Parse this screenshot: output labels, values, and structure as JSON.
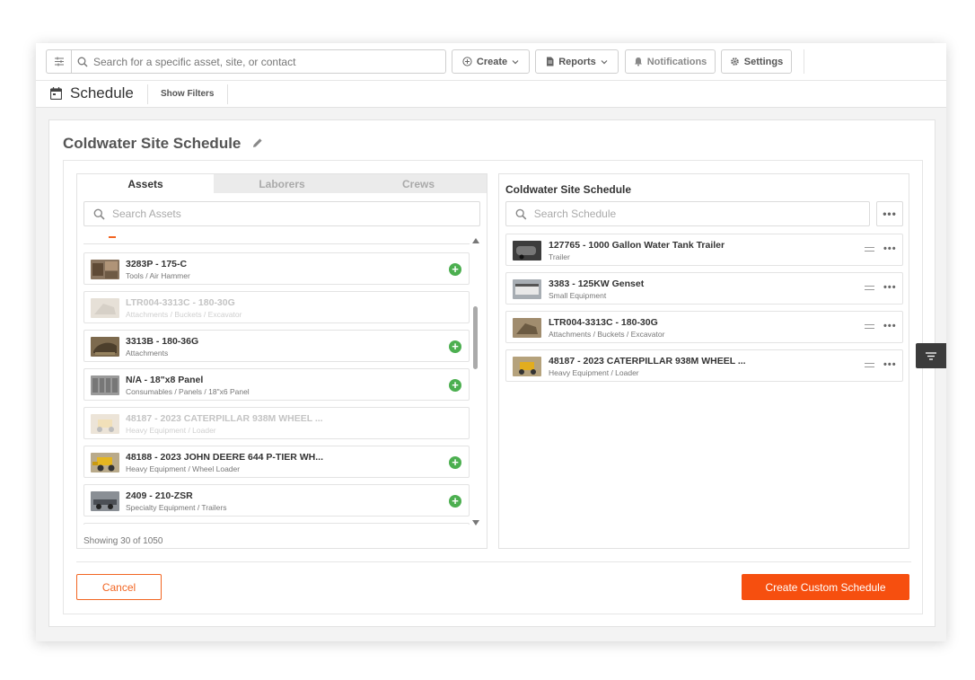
{
  "topbar": {
    "search_placeholder": "Search for a specific asset, site, or contact",
    "create_label": "Create",
    "reports_label": "Reports",
    "notifications_label": "Notifications",
    "settings_label": "Settings"
  },
  "subbar": {
    "title": "Schedule",
    "show_filters": "Show Filters"
  },
  "card": {
    "title": "Coldwater Site Schedule"
  },
  "tabs": [
    {
      "label": "Assets",
      "active": true
    },
    {
      "label": "Laborers",
      "active": false
    },
    {
      "label": "Crews",
      "active": false
    }
  ],
  "assets": {
    "search_placeholder": "Search Assets",
    "items": [
      {
        "name": "3283P - 175-C",
        "category": "Tools / Air Hammer",
        "enabled": true
      },
      {
        "name": "LTR004-3313C - 180-30G",
        "category": "Attachments / Buckets / Excavator",
        "enabled": false
      },
      {
        "name": "3313B - 180-36G",
        "category": "Attachments",
        "enabled": true
      },
      {
        "name": "N/A - 18\"x8 Panel",
        "category": "Consumables / Panels / 18\"x6 Panel",
        "enabled": true
      },
      {
        "name": "48187 - 2023 CATERPILLAR 938M WHEEL ...",
        "category": "Heavy Equipment / Loader",
        "enabled": false
      },
      {
        "name": "48188 - 2023 JOHN DEERE 644 P-TIER WH...",
        "category": "Heavy Equipment / Wheel Loader",
        "enabled": true
      },
      {
        "name": "2409 - 210-ZSR",
        "category": "Specialty Equipment / Trailers",
        "enabled": true
      }
    ],
    "showing": "Showing 30 of 1050"
  },
  "schedule": {
    "title": "Coldwater Site Schedule",
    "search_placeholder": "Search Schedule",
    "more_label": "•••",
    "items": [
      {
        "name": "127765 - 1000 Gallon Water Tank Trailer",
        "category": "Trailer"
      },
      {
        "name": "3383 - 125KW Genset",
        "category": "Small Equipment"
      },
      {
        "name": "LTR004-3313C - 180-30G",
        "category": "Attachments / Buckets / Excavator"
      },
      {
        "name": "48187 - 2023 CATERPILLAR 938M WHEEL ...",
        "category": "Heavy Equipment / Loader"
      }
    ]
  },
  "footer": {
    "cancel_label": "Cancel",
    "create_label": "Create Custom Schedule"
  },
  "colors": {
    "accent": "#f64f0f",
    "add": "#4caf50"
  }
}
